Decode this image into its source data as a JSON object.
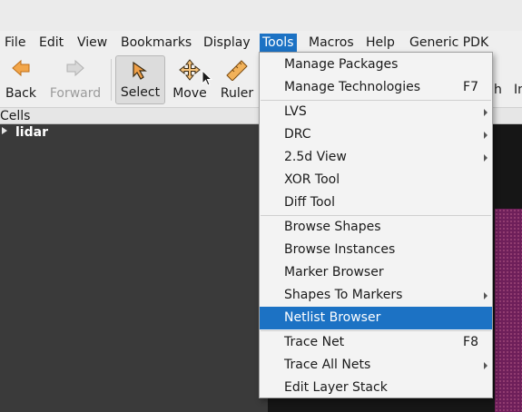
{
  "menubar": {
    "items": [
      {
        "label": "File"
      },
      {
        "label": "Edit"
      },
      {
        "label": "View"
      },
      {
        "label": "Bookmarks"
      },
      {
        "label": "Display"
      },
      {
        "label": "Tools"
      },
      {
        "label": "Macros"
      },
      {
        "label": "Help"
      },
      {
        "label": "Generic PDK"
      }
    ]
  },
  "toolbar": {
    "back": {
      "label": "Back",
      "icon": "arrow-left-icon",
      "color": "#e0892a"
    },
    "forward": {
      "label": "Forward",
      "icon": "arrow-right-icon",
      "disabled": true
    },
    "select": {
      "label": "Select",
      "icon": "select-pointer-icon",
      "checked": true
    },
    "move": {
      "label": "Move",
      "icon": "move-cross-icon"
    },
    "ruler": {
      "label": "Ruler",
      "icon": "ruler-icon"
    },
    "partial_right_1": "h",
    "partial_right_2": "In"
  },
  "cells_panel": {
    "title": "Cells",
    "tree": [
      {
        "label": "lidar",
        "expanded": false
      }
    ]
  },
  "tools_menu": {
    "items": [
      {
        "label": "Manage Packages",
        "shortcut": "",
        "submenu": false
      },
      {
        "label": "Manage Technologies",
        "shortcut": "F7",
        "submenu": false
      },
      {
        "label": "LVS",
        "shortcut": "",
        "submenu": true
      },
      {
        "label": "DRC",
        "shortcut": "",
        "submenu": true
      },
      {
        "label": "2.5d View",
        "shortcut": "",
        "submenu": true
      },
      {
        "label": "XOR Tool",
        "shortcut": "",
        "submenu": false
      },
      {
        "label": "Diff Tool",
        "shortcut": "",
        "submenu": false
      },
      {
        "label": "Browse Shapes",
        "shortcut": "",
        "submenu": false
      },
      {
        "label": "Browse Instances",
        "shortcut": "",
        "submenu": false
      },
      {
        "label": "Marker Browser",
        "shortcut": "",
        "submenu": false
      },
      {
        "label": "Shapes To Markers",
        "shortcut": "",
        "submenu": true
      },
      {
        "label": "Netlist Browser",
        "shortcut": "",
        "submenu": false,
        "highlighted": true
      },
      {
        "label": "Trace Net",
        "shortcut": "F8",
        "submenu": false
      },
      {
        "label": "Trace All Nets",
        "shortcut": "",
        "submenu": true
      },
      {
        "label": "Edit Layer Stack",
        "shortcut": "",
        "submenu": false
      }
    ]
  },
  "colors": {
    "highlight": "#1c72c4",
    "layout_purple": "#6e1f5a",
    "canvas_bg": "#161616"
  }
}
